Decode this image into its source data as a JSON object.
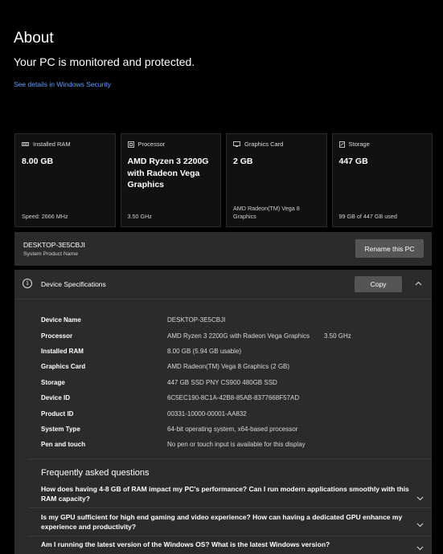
{
  "header": {
    "title": "About",
    "status": "Your PC is monitored and protected.",
    "security_link": "See details in Windows Security"
  },
  "cards": [
    {
      "icon": "ram-icon",
      "label": "Installed RAM",
      "value": "8.00 GB",
      "foot": "Speed: 2666 MHz"
    },
    {
      "icon": "processor-icon",
      "label": "Processor",
      "value": "AMD Ryzen 3 2200G with Radeon Vega Graphics",
      "foot": "3.50 GHz"
    },
    {
      "icon": "graphics-card-icon",
      "label": "Graphics Card",
      "value": "2 GB",
      "foot": "AMD Radeon(TM) Vega 8 Graphics"
    },
    {
      "icon": "storage-icon",
      "label": "Storage",
      "value": "447 GB",
      "foot": "99 GB of 447 GB used"
    }
  ],
  "pc": {
    "name": "DESKTOP-3E5CBJI",
    "subtitle": "System Product Name",
    "rename_label": "Rename this PC"
  },
  "specs": {
    "title": "Device Specifications",
    "copy_label": "Copy",
    "rows": [
      {
        "label": "Device Name",
        "value": "DESKTOP-3E5CBJI",
        "extra": ""
      },
      {
        "label": "Processor",
        "value": "AMD Ryzen 3 2200G with Radeon Vega Graphics",
        "extra": "3.50 GHz"
      },
      {
        "label": "Installed RAM",
        "value": "8.00 GB (5.94 GB usable)",
        "extra": ""
      },
      {
        "label": "Graphics Card",
        "value": "AMD Radeon(TM) Vega 8 Graphics (2 GB)",
        "extra": ""
      },
      {
        "label": "Storage",
        "value": "447 GB SSD PNY CS900 480GB SSD",
        "extra": ""
      },
      {
        "label": "Device ID",
        "value": "6C5EC190-8C1A-42B8-85AB-8377668F57AD",
        "extra": ""
      },
      {
        "label": "Product ID",
        "value": "00331-10000-00001-AA832",
        "extra": ""
      },
      {
        "label": "System Type",
        "value": "64-bit operating system, x64-based processor",
        "extra": ""
      },
      {
        "label": "Pen and touch",
        "value": "No pen or touch input is available for this display",
        "extra": ""
      }
    ]
  },
  "faq": {
    "title": "Frequently asked questions",
    "items": [
      "How does having 4-8 GB of RAM impact my PC's performance? Can I run modern applications smoothly with this RAM capacity?",
      "Is my GPU sufficient for high end gaming and video experience? How can having a dedicated GPU enhance my experience and productivity?",
      "Am I running the latest version of the Windows OS? What is the latest Windows version?"
    ]
  },
  "colors": {
    "background": "#000000",
    "panel": "#2b2b2b",
    "link": "#5ea0ff",
    "button": "#555555"
  }
}
